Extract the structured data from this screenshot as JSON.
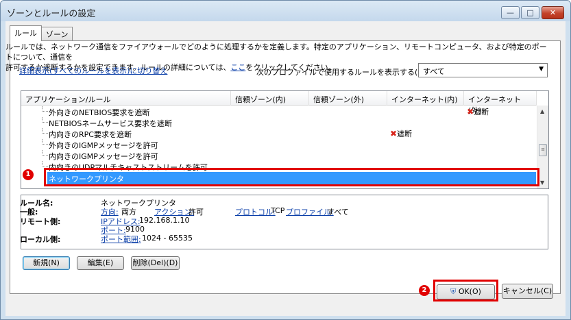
{
  "window": {
    "title": "ゾーンとルールの設定",
    "min_glyph": "—",
    "max_glyph": "□",
    "close_glyph": "✕"
  },
  "tabs": [
    {
      "label": "ルール",
      "selected": true
    },
    {
      "label": "ゾーン",
      "selected": false
    }
  ],
  "description": {
    "line1": "ルールでは、ネットワーク通信をファイアウォールでどのように処理するかを定義します。特定のアプリケーション、リモートコンピュータ、および特定のポートについて、通信を",
    "line2_prefix": "許可するか遮断するかを設定できます。ルールの詳細については、",
    "line2_link": "ここ",
    "line2_suffix": "をクリックしてください。"
  },
  "detail_link": "詳細表示(すべてのルールを表示)に切り替え",
  "profile": {
    "label": "次のプロファイルで使用するルールを表示する(P):",
    "selected": "すべて",
    "arrow": "▼"
  },
  "listview": {
    "columns": [
      "アプリケーション/ルール",
      "信頼ゾーン(内)",
      "信頼ゾーン(外)",
      "インターネット(内)",
      "インターネット(外)"
    ],
    "block_label": "遮断",
    "x_glyph": "✖",
    "rows": [
      {
        "name": "外向きのNETBIOS要求を遮断",
        "block_col": 4
      },
      {
        "name": "NETBIOSネームサービス要求を遮断",
        "block_col": -1
      },
      {
        "name": "内向きのRPC要求を遮断",
        "block_col": 3
      },
      {
        "name": "外向きのIGMPメッセージを許可",
        "block_col": -1
      },
      {
        "name": "内向きのIGMPメッセージを許可",
        "block_col": -1
      },
      {
        "name": "内向きのUDPマルチキャストストリームを許可",
        "block_col": -1
      },
      {
        "name": "ネットワークプリンタ",
        "block_col": -1,
        "selected": true
      }
    ],
    "scroll_up": "▲",
    "scroll_down": "▼",
    "scroll_grip": "≡"
  },
  "details": {
    "rule_name_label": "ルール名:",
    "rule_name": "ネットワークプリンタ",
    "general_label": "一般:",
    "direction_label": "方向:",
    "direction": "両方",
    "action_label": "アクション:",
    "action": "許可",
    "protocol_label": "プロトコル:",
    "protocol": "TCP",
    "profile_label": "プロファイル:",
    "profile": "すべて",
    "remote_label": "リモート側:",
    "ip_label": "IPアドレス:",
    "ip": "192.168.1.10",
    "port_label": "ポート:",
    "port": "9100",
    "local_label": "ローカル側:",
    "port_range_label": "ポート範囲:",
    "port_range": "1024 - 65535"
  },
  "buttons": {
    "new": "新規(N)",
    "edit": "編集(E)",
    "delete": "削除(Del)(D)",
    "ok": "OK(O)",
    "cancel": "キャンセル(C)"
  },
  "callouts": {
    "one": "1",
    "two": "2"
  },
  "colors": {
    "selection": "#3399ff",
    "callout_red": "#e10000",
    "block_x": "#d8261c"
  }
}
